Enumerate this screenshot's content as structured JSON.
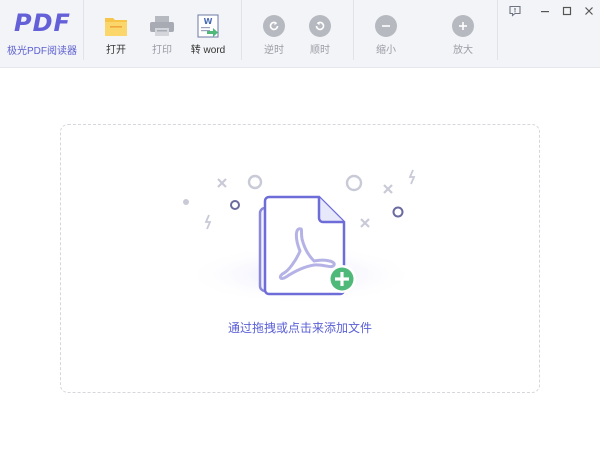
{
  "app": {
    "logo_mark": "PDF",
    "logo_name": "极光PDF阅读器"
  },
  "toolbar": {
    "open_label": "打开",
    "print_label": "打印",
    "to_word_label": "转 word",
    "rotate_ccw_label": "逆时",
    "rotate_cw_label": "顺时",
    "zoom_out_label": "缩小",
    "zoom_in_label": "放大"
  },
  "icons": {
    "open": "folder-icon",
    "print": "printer-icon",
    "to_word": "word-convert-icon",
    "rotate_ccw": "rotate-ccw-icon",
    "rotate_cw": "rotate-cw-icon",
    "zoom_out": "minus-circle-icon",
    "zoom_in": "plus-circle-icon",
    "feedback": "feedback-icon",
    "minimize": "minimize-icon",
    "maximize": "maximize-icon",
    "close": "close-icon"
  },
  "drop_zone": {
    "hint": "通过拖拽或点击来添加文件"
  },
  "colors": {
    "brand": "#6460d8",
    "toolbar_bg": "#f3f4f7",
    "disabled": "#b7b9c1",
    "add_badge": "#4fb97a",
    "folder": "#f6c54a"
  }
}
